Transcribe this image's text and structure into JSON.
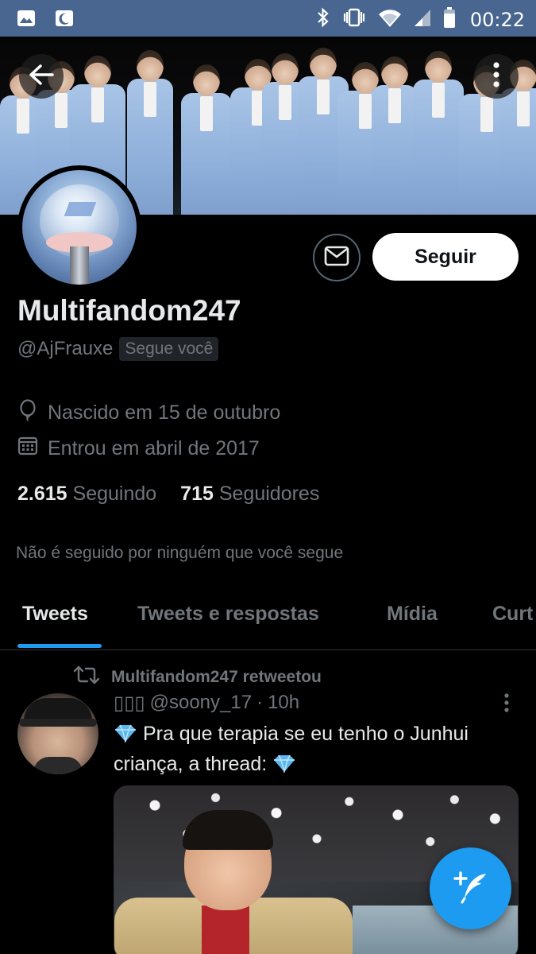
{
  "status_bar": {
    "time": "00:22",
    "left_icons": [
      "image-icon",
      "moon-icon"
    ],
    "right_icons": [
      "bluetooth-icon",
      "vibrate-icon",
      "wifi-icon",
      "signal-icon",
      "battery-icon"
    ]
  },
  "header": {
    "back_icon": "back-arrow-icon",
    "more_icon": "more-vertical-icon"
  },
  "profile": {
    "display_name": "Multifandom247",
    "handle": "@AjFrauxe",
    "follows_you": "Segue você",
    "follow_label": "Seguir",
    "birthday": "Nascido em 15 de outubro",
    "joined": "Entrou em abril de 2017",
    "following_count": "2.615",
    "following_label": "Seguindo",
    "followers_count": "715",
    "followers_label": "Seguidores",
    "not_followed_note": "Não é seguido por ninguém que você segue"
  },
  "tabs": [
    {
      "label": "Tweets",
      "active": true
    },
    {
      "label": "Tweets e respostas",
      "active": false
    },
    {
      "label": "Mídia",
      "active": false
    },
    {
      "label": "Curt",
      "active": false
    }
  ],
  "tweet": {
    "retweet_note": "Multifandom247 retweetou",
    "author_name": "▯▯▯",
    "author_handle": "@soony_17",
    "separator": "·",
    "time": "10h",
    "text_line1": "Pra que terapia se eu tenho o Junhui",
    "text_line2": "criança, a thread:"
  },
  "colors": {
    "accent": "#1d9bf0",
    "background": "#000000",
    "secondary_text": "#71767b",
    "status_bar": "#48668f"
  }
}
